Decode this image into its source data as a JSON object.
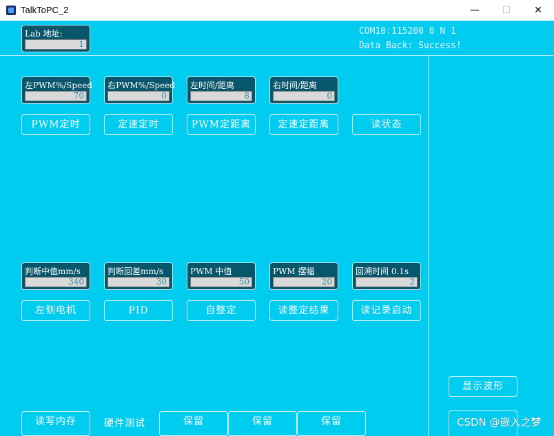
{
  "window": {
    "title": "TalkToPC_2",
    "minimize": "—",
    "maximize": "☐",
    "close": "✕"
  },
  "header": {
    "lab_address": {
      "label": "Lab 地址:",
      "value": "1"
    },
    "com_status": "COM10:115200 8 N 1",
    "data_back": "Data Back: Success!"
  },
  "row1_fields": [
    {
      "label": "左PWM%/Speed",
      "value": "70"
    },
    {
      "label": "右PWM%/Speed",
      "value": "0"
    },
    {
      "label": "左时间/距离",
      "value": "8"
    },
    {
      "label": "右时间/距离",
      "value": "0"
    }
  ],
  "row1_buttons": [
    "PWM定时",
    "定速定时",
    "PWM定距离",
    "定速定距离",
    "读状态"
  ],
  "row2_fields": [
    {
      "label": "判断中值mm/s",
      "value": "340"
    },
    {
      "label": "判断回差mm/s",
      "value": "30"
    },
    {
      "label": "PWM 中值",
      "value": "50"
    },
    {
      "label": "PWM 摆幅",
      "value": "20"
    },
    {
      "label": "回溯时间 0.1s",
      "value": "2"
    }
  ],
  "row2_buttons": [
    "左侧电机",
    "PID",
    "自整定",
    "读整定结果",
    "读记录启动"
  ],
  "right_panel": {
    "show_waveform": "显示波形"
  },
  "bottom": {
    "read_write_memory": "读写内存",
    "hardware_test": "硬件测试",
    "reserved": [
      "保留",
      "保留",
      "保留"
    ]
  },
  "watermark": "CSDN @嵌入之梦"
}
